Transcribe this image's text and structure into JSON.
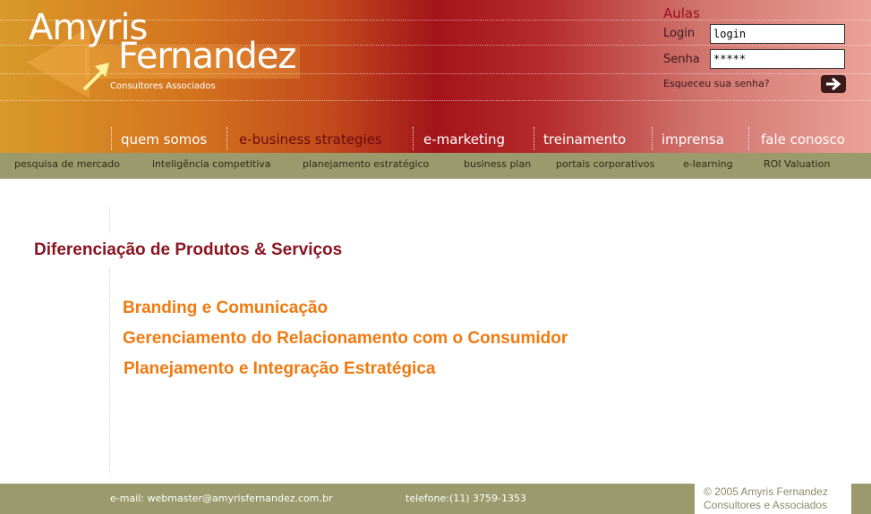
{
  "header": {
    "logo_line1": "Amyris",
    "logo_line2": "Fernandez",
    "logo_sub": "Consultores Associados"
  },
  "login": {
    "title": "Aulas",
    "login_label": "Login",
    "login_value": "login",
    "password_label": "Senha",
    "password_value": "*****",
    "forgot": "Esqueceu sua senha?",
    "submit_icon": "arrow-right-icon"
  },
  "nav": {
    "items": [
      {
        "label": "quem somos"
      },
      {
        "label": "e-business strategies",
        "active": true
      },
      {
        "label": "e-marketing"
      },
      {
        "label": "treinamento"
      },
      {
        "label": "imprensa"
      },
      {
        "label": "fale conosco"
      }
    ]
  },
  "subnav": {
    "items": [
      {
        "label": "pesquisa de mercado"
      },
      {
        "label": "inteligência competitiva"
      },
      {
        "label": "planejamento estratégico"
      },
      {
        "label": "business plan"
      },
      {
        "label": "portais corporativos"
      },
      {
        "label": "e-learning"
      },
      {
        "label": "ROI Valuation"
      }
    ]
  },
  "main": {
    "section_title": "Diferenciação de Produtos & Serviços",
    "items": [
      "Branding e Comunicação",
      "Gerenciamento do Relacionamento com o Consumidor",
      "Planejamento e Integração Estratégica"
    ]
  },
  "footer": {
    "email": "e-mail: webmaster@amyrisfernandez.com.br",
    "phone": "telefone:(11) 3759-1353",
    "copyright_line1": "© 2005 Amyris Fernandez",
    "copyright_line2": "Consultores e Associados"
  },
  "colors": {
    "brand_red": "#9a1020",
    "accent_orange": "#f07a10",
    "bar_olive": "#9a9a6c"
  }
}
